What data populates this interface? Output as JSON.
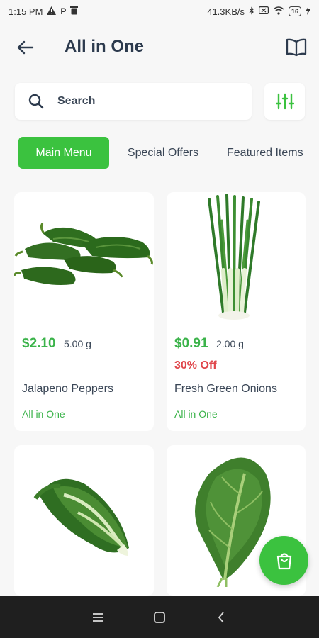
{
  "status_bar": {
    "time": "1:15 PM",
    "left_icons": [
      "warning-icon",
      "parking-icon",
      "trash-icon"
    ],
    "network_speed": "41.3KB/s",
    "battery_level": "16",
    "right_icons": [
      "bluetooth-icon",
      "sim-icon",
      "wifi-icon",
      "battery-icon",
      "charging-icon"
    ]
  },
  "header": {
    "title": "All in One",
    "back_icon": "arrow-left-icon",
    "menu_icon": "book-open-icon"
  },
  "search": {
    "placeholder": "Search",
    "icon": "search-icon",
    "filter_icon": "sliders-icon"
  },
  "tabs": [
    {
      "label": "Main Menu",
      "active": true
    },
    {
      "label": "Special Offers",
      "active": false
    },
    {
      "label": "Featured Items",
      "active": false
    }
  ],
  "products": [
    {
      "price": "$2.10",
      "weight": "5.00 g",
      "discount": "",
      "name": "Jalapeno Peppers",
      "store": "All in One",
      "image": "jalapeno-peppers"
    },
    {
      "price": "$0.91",
      "weight": "2.00 g",
      "discount": "30% Off",
      "name": "Fresh Green Onions",
      "store": "All in One",
      "image": "green-onions"
    },
    {
      "price": "",
      "weight": "",
      "discount": "",
      "name": "",
      "store": "",
      "image": "romaine-lettuce"
    },
    {
      "price": "",
      "weight": "",
      "discount": "",
      "name": "",
      "store": "",
      "image": "collard-greens"
    }
  ],
  "fab": {
    "icon": "shopping-bag-icon"
  },
  "nav_bar": {
    "icons": [
      "menu-icon",
      "home-square-icon",
      "back-chevron-icon"
    ]
  },
  "colors": {
    "accent": "#3bc23f",
    "price": "#3bb34a",
    "discount": "#e0474c",
    "text": "#2c3a4d",
    "background": "#f7f7f7"
  }
}
